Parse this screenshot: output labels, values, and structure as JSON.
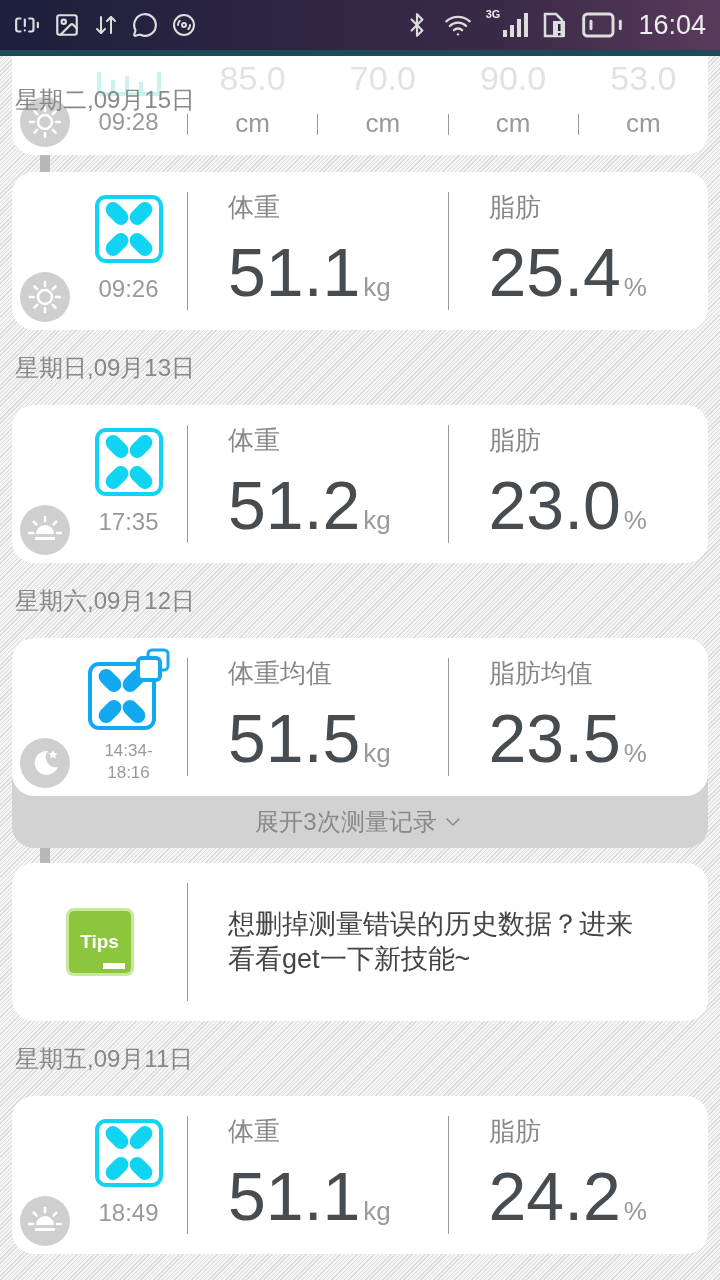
{
  "status_bar": {
    "network": "3G",
    "time": "16:04"
  },
  "sticky_date": "星期二,09月15日",
  "partial_card": {
    "time": "09:28",
    "period_icon": {
      "kind": "sun"
    },
    "columns": [
      {
        "value": "85.0",
        "unit": "cm"
      },
      {
        "value": "70.0",
        "unit": "cm"
      },
      {
        "value": "90.0",
        "unit": "cm"
      },
      {
        "value": "53.0",
        "unit": "cm"
      }
    ]
  },
  "items": [
    {
      "kind": "record",
      "period_icon": {
        "kind": "sun"
      },
      "time": "09:26",
      "metrics": [
        {
          "label": "体重",
          "value": "51.1",
          "unit": "kg"
        },
        {
          "label": "脂肪",
          "value": "25.4",
          "unit": "%"
        }
      ]
    },
    {
      "kind": "date",
      "text": "星期日,09月13日"
    },
    {
      "kind": "record",
      "period_icon": {
        "kind": "sunrise"
      },
      "time": "17:35",
      "metrics": [
        {
          "label": "体重",
          "value": "51.2",
          "unit": "kg"
        },
        {
          "label": "脂肪",
          "value": "23.0",
          "unit": "%"
        }
      ]
    },
    {
      "kind": "date",
      "text": "星期六,09月12日"
    },
    {
      "kind": "average",
      "period_icon": {
        "kind": "moon"
      },
      "time": "14:34-18:16",
      "metrics": [
        {
          "label": "体重均值",
          "value": "51.5",
          "unit": "kg"
        },
        {
          "label": "脂肪均值",
          "value": "23.5",
          "unit": "%"
        }
      ],
      "expand": "展开3次测量记录"
    },
    {
      "kind": "tips",
      "badge": "Tips",
      "text": "想删掉测量错误的历史数据？进来看看get一下新技能~"
    },
    {
      "kind": "date",
      "text": "星期五,09月11日"
    },
    {
      "kind": "record",
      "period_icon": {
        "kind": "sunrise"
      },
      "time": "18:49",
      "metrics": [
        {
          "label": "体重",
          "value": "51.1",
          "unit": "kg"
        },
        {
          "label": "脂肪",
          "value": "24.2",
          "unit": "%"
        }
      ]
    }
  ]
}
